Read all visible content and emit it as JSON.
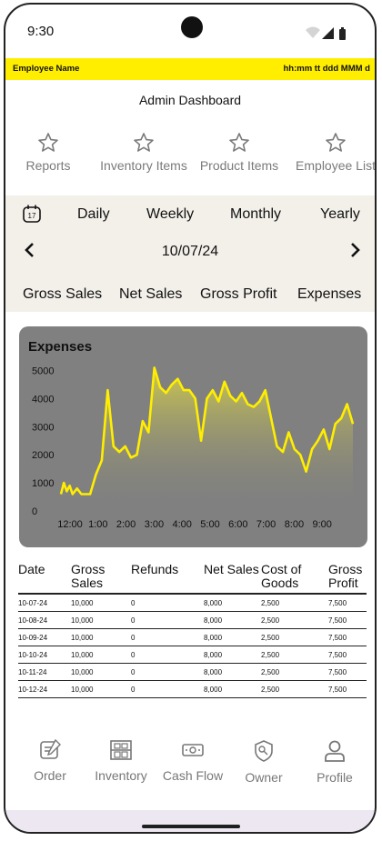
{
  "status": {
    "time": "9:30"
  },
  "header": {
    "employee_name": "Employee Name",
    "datetime_format": "hh:mm tt ddd MMM d"
  },
  "page_title": "Admin Dashboard",
  "quick_actions": [
    {
      "label": "Reports",
      "icon": "star-icon"
    },
    {
      "label": "Inventory Items",
      "icon": "star-icon"
    },
    {
      "label": "Product Items",
      "icon": "star-icon"
    },
    {
      "label": "Employee List",
      "icon": "star-icon"
    }
  ],
  "periods": [
    "Daily",
    "Weekly",
    "Monthly",
    "Yearly"
  ],
  "calendar_icon_day": "17",
  "current_date": "10/07/24",
  "metric_tabs": [
    "Gross Sales",
    "Net Sales",
    "Gross Profit",
    "Expenses"
  ],
  "colors": {
    "accent": "#ffee00",
    "chart_bg": "#808080",
    "panel_bg": "#f3f0ea"
  },
  "chart_data": {
    "type": "area",
    "title": "Expenses",
    "x_ticks": [
      "12:00",
      "1:00",
      "2:00",
      "3:00",
      "4:00",
      "5:00",
      "6:00",
      "7:00",
      "8:00",
      "9:00"
    ],
    "y_ticks": [
      0,
      1000,
      2000,
      3000,
      4000,
      5000
    ],
    "ylim": [
      0,
      5500
    ],
    "xlim": [
      0,
      10
    ],
    "grid": false,
    "series": [
      {
        "x": [
          0,
          0.1,
          0.2,
          0.3,
          0.4,
          0.55,
          0.7,
          0.85,
          1.0,
          1.2,
          1.4,
          1.6,
          1.8,
          2.0,
          2.2,
          2.4,
          2.6,
          2.8,
          3.0,
          3.2,
          3.4,
          3.6,
          3.8,
          4.0,
          4.2,
          4.4,
          4.6,
          4.8,
          5.0,
          5.2,
          5.4,
          5.6,
          5.8,
          6.0,
          6.2,
          6.4,
          6.6,
          6.8,
          7.0,
          7.2,
          7.4,
          7.6,
          7.8,
          8.0,
          8.2,
          8.4,
          8.6,
          8.8,
          9.0,
          9.2,
          9.4,
          9.6,
          9.8,
          10.0
        ],
        "y": [
          600,
          1000,
          700,
          900,
          600,
          800,
          600,
          600,
          600,
          1300,
          1800,
          4300,
          2300,
          2100,
          2300,
          1900,
          2000,
          3200,
          2800,
          5100,
          4400,
          4200,
          4500,
          4700,
          4300,
          4300,
          4000,
          2500,
          4000,
          4300,
          3900,
          4600,
          4100,
          3900,
          4200,
          3800,
          3700,
          3900,
          4300,
          3300,
          2300,
          2100,
          2800,
          2200,
          2000,
          1400,
          2200,
          2500,
          2900,
          2200,
          3100,
          3300,
          3800,
          3100
        ]
      }
    ]
  },
  "table": {
    "headers": [
      "Date",
      "Gross Sales",
      "Refunds",
      "Net Sales",
      "Cost of Goods",
      "Gross Profit"
    ],
    "rows": [
      [
        "10-07-24",
        "10,000",
        "0",
        "8,000",
        "2,500",
        "7,500"
      ],
      [
        "10-08-24",
        "10,000",
        "0",
        "8,000",
        "2,500",
        "7,500"
      ],
      [
        "10-09-24",
        "10,000",
        "0",
        "8,000",
        "2,500",
        "7,500"
      ],
      [
        "10-10-24",
        "10,000",
        "0",
        "8,000",
        "2,500",
        "7,500"
      ],
      [
        "10-11-24",
        "10,000",
        "0",
        "8,000",
        "2,500",
        "7,500"
      ],
      [
        "10-12-24",
        "10,000",
        "0",
        "8,000",
        "2,500",
        "7,500"
      ]
    ]
  },
  "bottom_nav": [
    {
      "label": "Order",
      "icon": "order-icon"
    },
    {
      "label": "Inventory",
      "icon": "inventory-icon"
    },
    {
      "label": "Cash Flow",
      "icon": "cash-flow-icon"
    },
    {
      "label": "Owner",
      "icon": "owner-icon"
    },
    {
      "label": "Profile",
      "icon": "profile-icon"
    }
  ]
}
